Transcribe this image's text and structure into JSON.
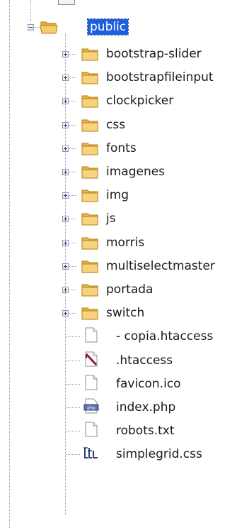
{
  "tree": {
    "root": {
      "label": "public",
      "icon": "folder-open-icon",
      "expanded": true,
      "selected": true
    },
    "folders": [
      {
        "label": "bootstrap-slider",
        "icon": "folder-icon"
      },
      {
        "label": "bootstrapfileinput",
        "icon": "folder-icon"
      },
      {
        "label": "clockpicker",
        "icon": "folder-icon"
      },
      {
        "label": "css",
        "icon": "folder-icon"
      },
      {
        "label": "fonts",
        "icon": "folder-icon"
      },
      {
        "label": "imagenes",
        "icon": "folder-icon"
      },
      {
        "label": "img",
        "icon": "folder-icon"
      },
      {
        "label": "js",
        "icon": "folder-icon"
      },
      {
        "label": "morris",
        "icon": "folder-icon"
      },
      {
        "label": "multiselectmaster",
        "icon": "folder-icon"
      },
      {
        "label": "portada",
        "icon": "folder-icon"
      },
      {
        "label": "switch",
        "icon": "folder-icon"
      }
    ],
    "files": [
      {
        "label": " - copia.htaccess",
        "icon": "blank-file-icon"
      },
      {
        "label": ".htaccess",
        "icon": "htaccess-file-icon"
      },
      {
        "label": "favicon.ico",
        "icon": "blank-file-icon"
      },
      {
        "label": "index.php",
        "icon": "php-file-icon"
      },
      {
        "label": "robots.txt",
        "icon": "blank-file-icon"
      },
      {
        "label": "simplegrid.css",
        "icon": "css-file-icon"
      }
    ]
  },
  "colors": {
    "selection": "#1e5fe0",
    "folder": "#f3c45a",
    "guide": "#9a9a9a"
  }
}
